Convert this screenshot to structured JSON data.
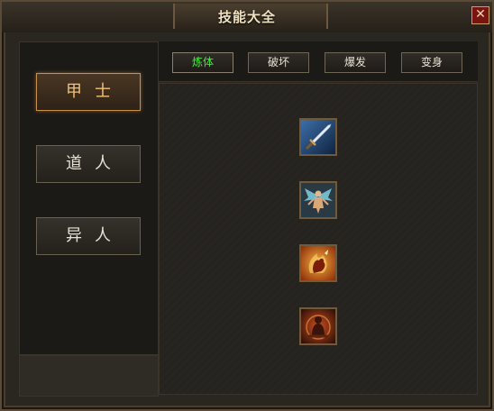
{
  "window": {
    "title": "技能大全",
    "close_glyph": "✕"
  },
  "classes": [
    {
      "label": "甲士",
      "active": true
    },
    {
      "label": "道人",
      "active": false
    },
    {
      "label": "异人",
      "active": false
    }
  ],
  "tabs": [
    {
      "label": "炼体",
      "active": true
    },
    {
      "label": "破坏",
      "active": false
    },
    {
      "label": "爆发",
      "active": false
    },
    {
      "label": "变身",
      "active": false
    }
  ],
  "skills": [
    {
      "icon": "sword-icon"
    },
    {
      "icon": "winged-figure-icon"
    },
    {
      "icon": "flame-fist-icon"
    },
    {
      "icon": "meditating-monk-icon"
    }
  ],
  "colors": {
    "active_tab_text": "#3ff03c",
    "active_class_text": "#f2c078",
    "frame": "#5a4a36"
  }
}
